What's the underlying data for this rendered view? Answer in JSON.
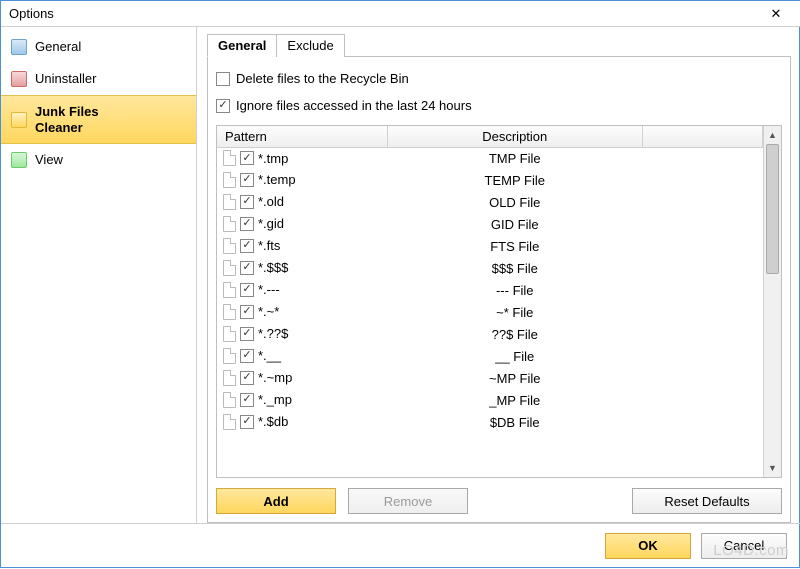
{
  "window": {
    "title": "Options",
    "close": "✕"
  },
  "sidebar": {
    "items": [
      {
        "label": "General"
      },
      {
        "label": "Uninstaller"
      },
      {
        "label": "Junk Files\nCleaner"
      },
      {
        "label": "View"
      }
    ]
  },
  "tabs": {
    "general": "General",
    "exclude": "Exclude"
  },
  "options": {
    "delete_recycle": {
      "label": "Delete files to the Recycle Bin",
      "checked": false
    },
    "ignore_recent": {
      "label": "Ignore files accessed in the last 24 hours",
      "checked": true
    }
  },
  "table": {
    "headers": {
      "pattern": "Pattern",
      "description": "Description"
    },
    "rows": [
      {
        "checked": true,
        "pattern": "*.tmp",
        "desc": "TMP File"
      },
      {
        "checked": true,
        "pattern": "*.temp",
        "desc": "TEMP File"
      },
      {
        "checked": true,
        "pattern": "*.old",
        "desc": "OLD File"
      },
      {
        "checked": true,
        "pattern": "*.gid",
        "desc": "GID File"
      },
      {
        "checked": true,
        "pattern": "*.fts",
        "desc": "FTS File"
      },
      {
        "checked": true,
        "pattern": "*.$$$",
        "desc": "$$$ File"
      },
      {
        "checked": true,
        "pattern": "*.---",
        "desc": "--- File"
      },
      {
        "checked": true,
        "pattern": "*.~*",
        "desc": "~* File"
      },
      {
        "checked": true,
        "pattern": "*.??$",
        "desc": "??$ File"
      },
      {
        "checked": true,
        "pattern": "*.__",
        "desc": "__ File"
      },
      {
        "checked": true,
        "pattern": "*.~mp",
        "desc": "~MP File"
      },
      {
        "checked": true,
        "pattern": "*._mp",
        "desc": "_MP File"
      },
      {
        "checked": true,
        "pattern": "*.$db",
        "desc": "$DB File"
      }
    ]
  },
  "buttons": {
    "add": "Add",
    "remove": "Remove",
    "reset": "Reset Defaults",
    "ok": "OK",
    "cancel": "Cancel"
  },
  "watermark": "LO4D.com"
}
